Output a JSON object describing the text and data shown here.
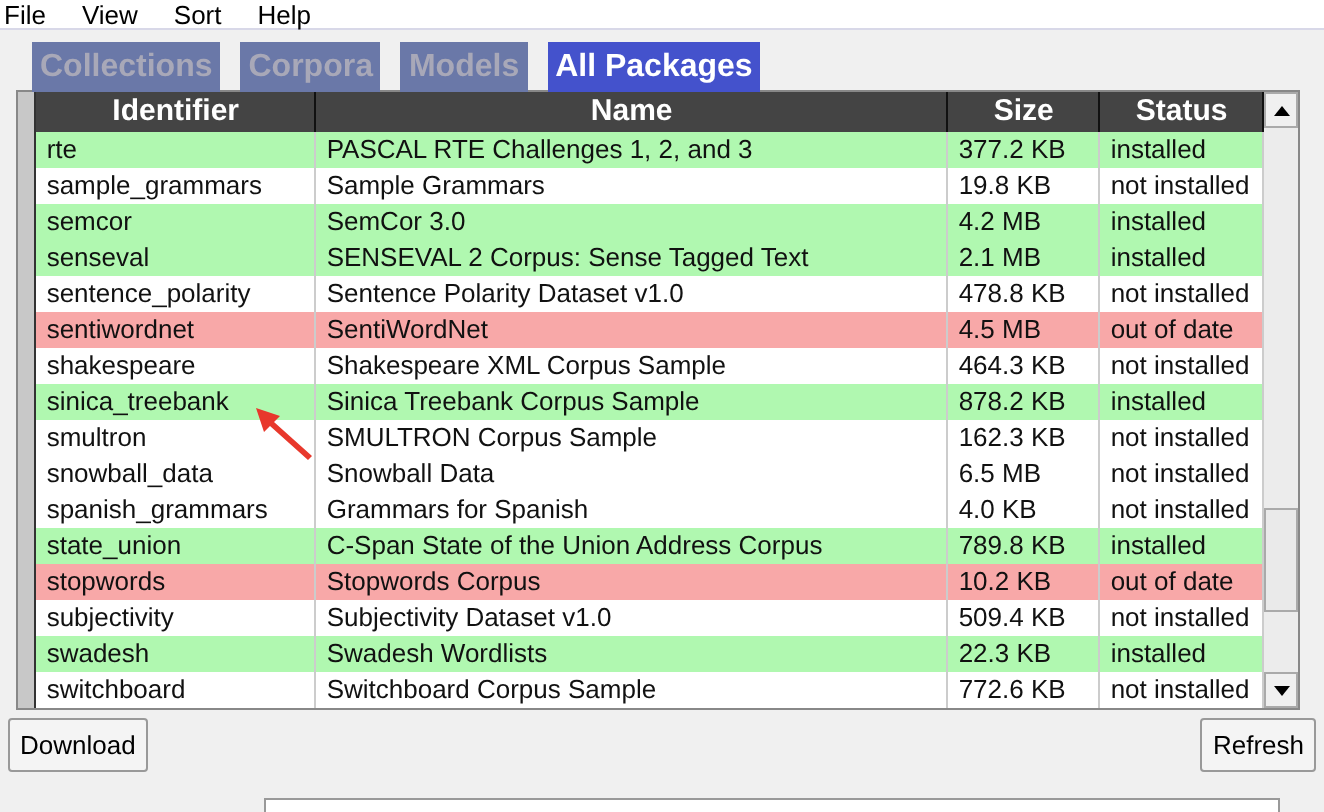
{
  "menu": [
    "File",
    "View",
    "Sort",
    "Help"
  ],
  "tabs": [
    {
      "label": "Collections",
      "selected": false
    },
    {
      "label": "Corpora",
      "selected": false
    },
    {
      "label": "Models",
      "selected": false
    },
    {
      "label": "All Packages",
      "selected": true
    }
  ],
  "table": {
    "columns": [
      "Identifier",
      "Name",
      "Size",
      "Status"
    ],
    "rows": [
      {
        "identifier": "rte",
        "name": "PASCAL RTE Challenges 1, 2, and 3",
        "size": "377.2 KB",
        "status": "installed",
        "kind": "installed"
      },
      {
        "identifier": "sample_grammars",
        "name": "Sample Grammars",
        "size": "19.8 KB",
        "status": "not installed",
        "kind": "not_installed"
      },
      {
        "identifier": "semcor",
        "name": "SemCor 3.0",
        "size": "4.2 MB",
        "status": "installed",
        "kind": "installed"
      },
      {
        "identifier": "senseval",
        "name": "SENSEVAL 2 Corpus: Sense Tagged Text",
        "size": "2.1 MB",
        "status": "installed",
        "kind": "installed"
      },
      {
        "identifier": "sentence_polarity",
        "name": "Sentence Polarity Dataset v1.0",
        "size": "478.8 KB",
        "status": "not installed",
        "kind": "not_installed"
      },
      {
        "identifier": "sentiwordnet",
        "name": "SentiWordNet",
        "size": "4.5 MB",
        "status": "out of date",
        "kind": "out_of_date"
      },
      {
        "identifier": "shakespeare",
        "name": "Shakespeare XML Corpus Sample",
        "size": "464.3 KB",
        "status": "not installed",
        "kind": "not_installed"
      },
      {
        "identifier": "sinica_treebank",
        "name": "Sinica Treebank Corpus Sample",
        "size": "878.2 KB",
        "status": "installed",
        "kind": "installed",
        "annotated": true
      },
      {
        "identifier": "smultron",
        "name": "SMULTRON Corpus Sample",
        "size": "162.3 KB",
        "status": "not installed",
        "kind": "not_installed"
      },
      {
        "identifier": "snowball_data",
        "name": "Snowball Data",
        "size": "6.5 MB",
        "status": "not installed",
        "kind": "not_installed"
      },
      {
        "identifier": "spanish_grammars",
        "name": "Grammars for Spanish",
        "size": "4.0 KB",
        "status": "not installed",
        "kind": "not_installed"
      },
      {
        "identifier": "state_union",
        "name": "C-Span State of the Union Address Corpus",
        "size": "789.8 KB",
        "status": "installed",
        "kind": "installed"
      },
      {
        "identifier": "stopwords",
        "name": "Stopwords Corpus",
        "size": "10.2 KB",
        "status": "out of date",
        "kind": "out_of_date"
      },
      {
        "identifier": "subjectivity",
        "name": "Subjectivity Dataset v1.0",
        "size": "509.4 KB",
        "status": "not installed",
        "kind": "not_installed"
      },
      {
        "identifier": "swadesh",
        "name": "Swadesh Wordlists",
        "size": "22.3 KB",
        "status": "installed",
        "kind": "installed"
      },
      {
        "identifier": "switchboard",
        "name": "Switchboard Corpus Sample",
        "size": "772.6 KB",
        "status": "not installed",
        "kind": "not_installed"
      }
    ]
  },
  "buttons": [
    "Download",
    "Refresh"
  ]
}
